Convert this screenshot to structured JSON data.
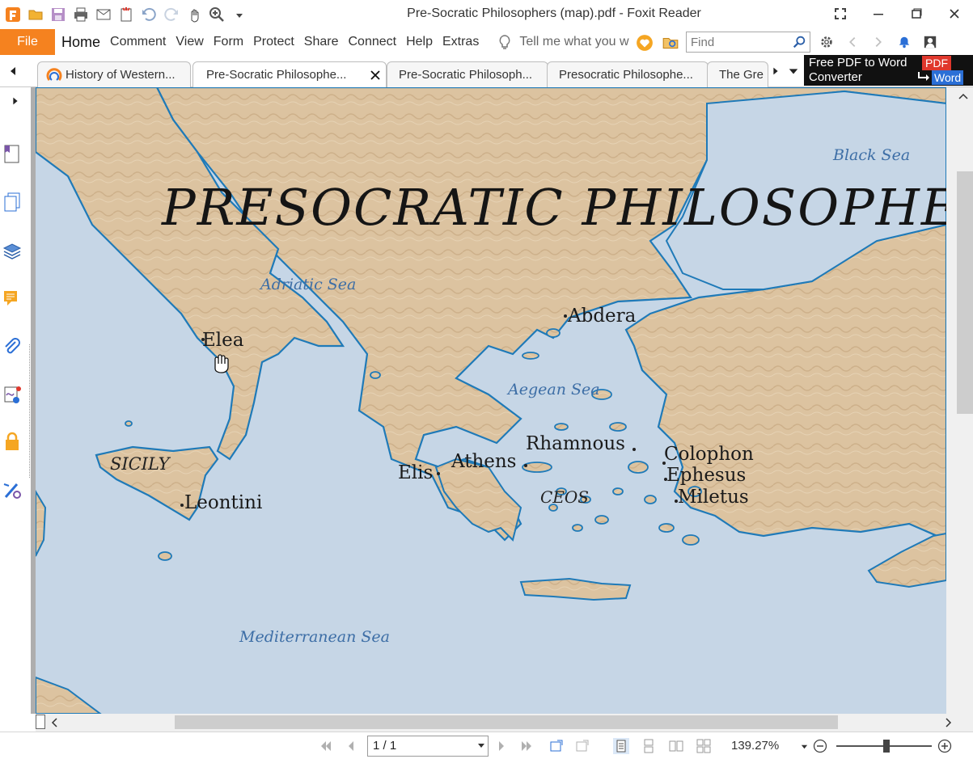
{
  "window": {
    "title": "Pre-Socratic Philosophers (map).pdf - Foxit Reader"
  },
  "menu": {
    "file": "File",
    "items": [
      "Home",
      "Comment",
      "View",
      "Form",
      "Protect",
      "Share",
      "Connect",
      "Help",
      "Extras"
    ],
    "tell_me": "Tell me what you w",
    "find_placeholder": "Find"
  },
  "tabs": [
    {
      "label": "History of Western...",
      "active": false
    },
    {
      "label": "Pre-Socratic Philosophe...",
      "active": true
    },
    {
      "label": "Pre-Socratic Philosoph...",
      "active": false
    },
    {
      "label": "Presocratic Philosophe...",
      "active": false
    },
    {
      "label": "The Gre",
      "active": false
    }
  ],
  "ad": {
    "line1": "Free PDF to Word",
    "line2": "Converter",
    "badge_pdf": "PDF",
    "badge_word": "Word"
  },
  "map": {
    "title": "PRESOCRATIC PHILOSOPHERS",
    "seas": [
      "Black Sea",
      "Adriatic Sea",
      "Aegean Sea",
      "Mediterranean Sea"
    ],
    "regions": [
      "SICILY",
      "CEOS"
    ],
    "cities": [
      "Abdera",
      "Elea",
      "Rhamnous",
      "Colophon",
      "Ephesus",
      "Miletus",
      "Athens",
      "Elis",
      "Leontini"
    ]
  },
  "status": {
    "page": "1 / 1",
    "zoom": "139.27%"
  },
  "colors": {
    "accent": "#f5821f",
    "sea": "#c6d6e6",
    "land": "#dcc3a0",
    "coast": "#1f7ab8"
  }
}
